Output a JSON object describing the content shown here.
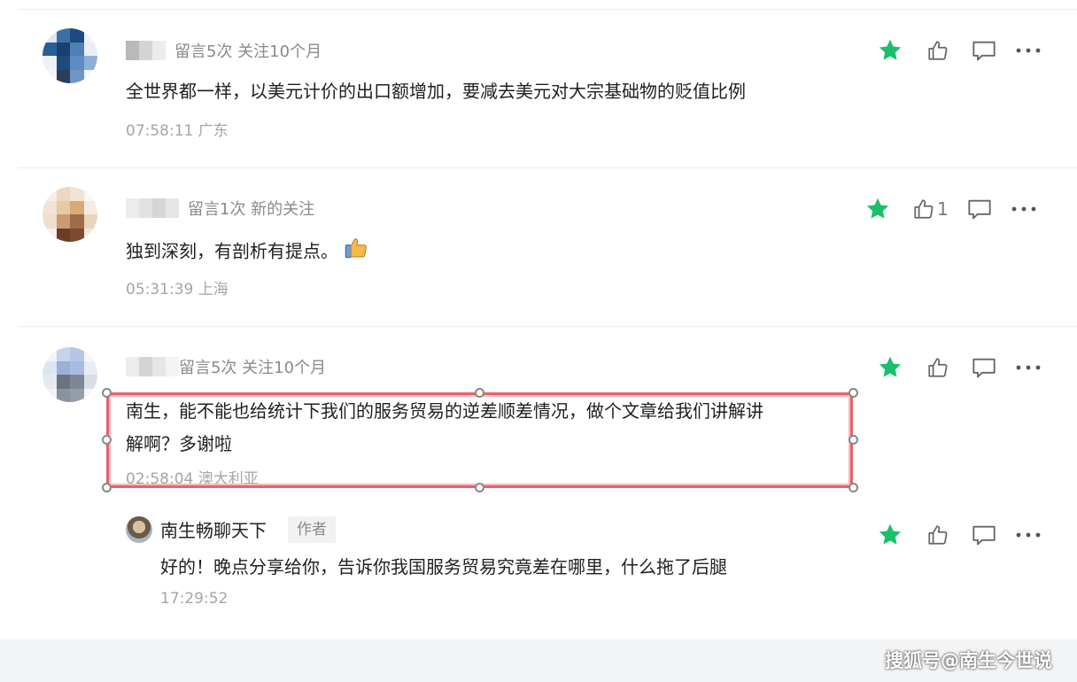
{
  "comments": [
    {
      "meta": "留言5次 关注10个月",
      "text": "全世界都一样，以美元计价的出口额增加，要减去美元对大宗基础物的贬值比例",
      "time": "07:58:11 广东",
      "liked": true,
      "like_count": ""
    },
    {
      "meta": "留言1次 新的关注",
      "text": "独到深刻，有剖析有提点。",
      "time": "05:31:39 上海",
      "liked": true,
      "like_count": "1",
      "emoji": "thumbs-up-emoji"
    },
    {
      "meta": "留言5次 关注10个月",
      "text_line1": "南生，能不能也给统计下我们的服务贸易的逆差顺差情况，做个文章给我们讲解讲",
      "text_line2": "解啊？多谢啦",
      "time": "02:58:04 澳大利亚",
      "liked": true,
      "like_count": ""
    }
  ],
  "reply": {
    "author": "南生畅聊天下",
    "tag": "作者",
    "text": "好的！晚点分享给你，告诉你我国服务贸易究竟差在哪里，什么拖了后腿",
    "time": "17:29:52",
    "liked": true
  },
  "watermark": "搜狐号@南生今世说",
  "icons": {
    "featured": "star-icon",
    "like": "thumbs-up-icon",
    "reply": "comment-icon",
    "more": "more-icon"
  },
  "colors": {
    "star": "#19c06b",
    "selection": "#e8626b"
  }
}
